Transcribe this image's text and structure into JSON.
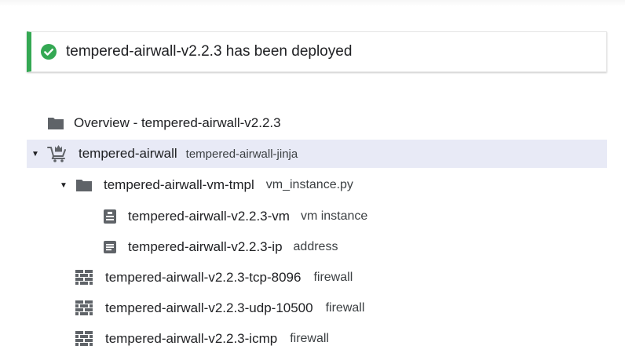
{
  "notification": {
    "message": "tempered-airwall-v2.2.3 has been deployed",
    "status_color": "#34a853"
  },
  "tree": {
    "overview": {
      "label": "Overview - tempered-airwall-v2.2.3",
      "icon": "folder-icon"
    },
    "deployment": {
      "name": "tempered-airwall",
      "type": "tempered-airwall-jinja",
      "icon": "marketplace-cart-icon",
      "expanded": true
    },
    "template": {
      "name": "tempered-airwall-vm-tmpl",
      "type": "vm_instance.py",
      "icon": "folder-icon",
      "expanded": true
    },
    "resources": [
      {
        "name": "tempered-airwall-v2.2.3-vm",
        "type": "vm instance",
        "icon": "vm-instance-icon"
      },
      {
        "name": "tempered-airwall-v2.2.3-ip",
        "type": "address",
        "icon": "address-icon"
      },
      {
        "name": "tempered-airwall-v2.2.3-tcp-8096",
        "type": "firewall",
        "icon": "firewall-icon"
      },
      {
        "name": "tempered-airwall-v2.2.3-udp-10500",
        "type": "firewall",
        "icon": "firewall-icon"
      },
      {
        "name": "tempered-airwall-v2.2.3-icmp",
        "type": "firewall",
        "icon": "firewall-icon"
      }
    ]
  },
  "colors": {
    "selected_row": "#e8eaf6",
    "icon_gray": "#5f6368",
    "success_green": "#34a853"
  }
}
